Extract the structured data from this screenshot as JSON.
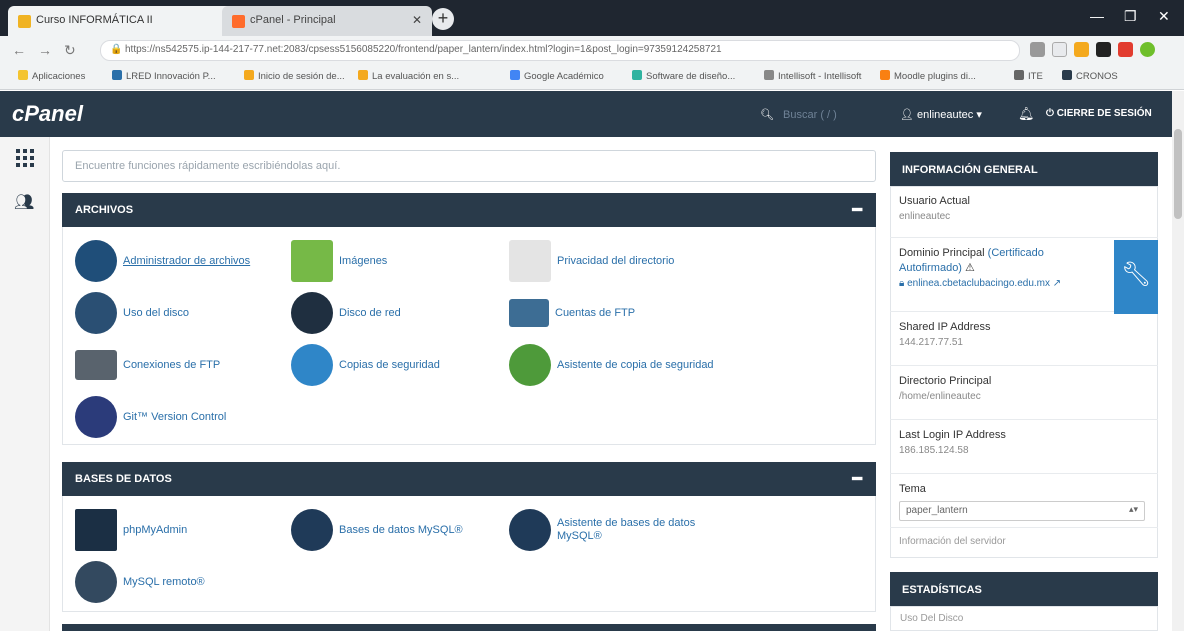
{
  "browser": {
    "tabs": [
      {
        "label": "Curso INFORMÁTICA II"
      },
      {
        "label": "cPanel - Principal"
      }
    ],
    "url": "https://ns542575.ip-144-217-77.net:2083/cpsess5156085220/frontend/paper_lantern/index.html?login=1&post_login=97359124258721",
    "bookmarks": [
      "Aplicaciones",
      "LRED Innovación P...",
      "Inicio de sesión de...",
      "La evaluación en s...",
      "Google Académico",
      "Software de diseño...",
      "Intellisoft - Intellisoft",
      "Moodle plugins di...",
      "ITE",
      "CRONOS"
    ]
  },
  "header": {
    "logo": "cPanel",
    "search_placeholder": "Buscar ( / )",
    "user": "enlineautec",
    "logout": "CIERRE DE SESIÓN"
  },
  "main": {
    "search_placeholder": "Encuentre funciones rápidamente escribiéndolas aquí.",
    "archivos": {
      "title": "ARCHIVOS",
      "items": [
        "Administrador de archivos",
        "Imágenes",
        "Privacidad del directorio",
        "Uso del disco",
        "Disco de red",
        "Cuentas de FTP",
        "Conexiones de FTP",
        "Copias de seguridad",
        "Asistente de copia de seguridad",
        "Git™ Version Control"
      ]
    },
    "bases": {
      "title": "BASES DE DATOS",
      "items": [
        "phpMyAdmin",
        "Bases de datos MySQL®",
        "Asistente de bases de datos MySQL®",
        "MySQL remoto®"
      ]
    }
  },
  "sidebar": {
    "general_title": "INFORMACIÓN GENERAL",
    "usuario_label": "Usuario Actual",
    "usuario_value": "enlineautec",
    "dominio_label": "Dominio Principal",
    "dominio_cert": "(Certificado Autofirmado)",
    "dominio_value": "enlinea.cbetaclubacingo.edu.mx",
    "ip_label": "Shared IP Address",
    "ip_value": "144.217.77.51",
    "dir_label": "Directorio Principal",
    "dir_value": "/home/enlineautec",
    "last_login_label": "Last Login IP Address",
    "last_login_value": "186.185.124.58",
    "tema_label": "Tema",
    "tema_value": "paper_lantern",
    "server_info": "Información del servidor",
    "stats_title": "ESTADÍSTICAS",
    "stats_first": "Uso Del Disco"
  }
}
